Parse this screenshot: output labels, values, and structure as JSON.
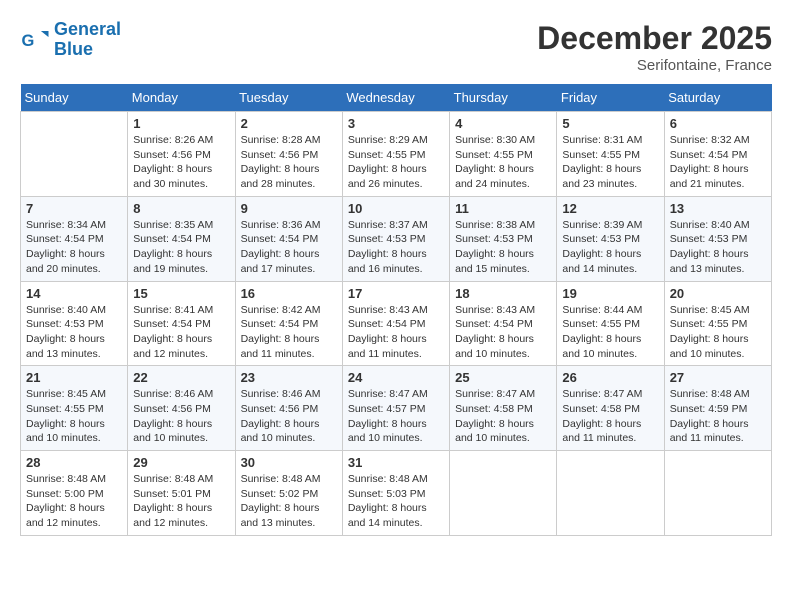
{
  "header": {
    "logo_line1": "General",
    "logo_line2": "Blue",
    "month_title": "December 2025",
    "location": "Serifontaine, France"
  },
  "days_of_week": [
    "Sunday",
    "Monday",
    "Tuesday",
    "Wednesday",
    "Thursday",
    "Friday",
    "Saturday"
  ],
  "weeks": [
    [
      {
        "day": "",
        "sunrise": "",
        "sunset": "",
        "daylight": ""
      },
      {
        "day": "1",
        "sunrise": "Sunrise: 8:26 AM",
        "sunset": "Sunset: 4:56 PM",
        "daylight": "Daylight: 8 hours and 30 minutes."
      },
      {
        "day": "2",
        "sunrise": "Sunrise: 8:28 AM",
        "sunset": "Sunset: 4:56 PM",
        "daylight": "Daylight: 8 hours and 28 minutes."
      },
      {
        "day": "3",
        "sunrise": "Sunrise: 8:29 AM",
        "sunset": "Sunset: 4:55 PM",
        "daylight": "Daylight: 8 hours and 26 minutes."
      },
      {
        "day": "4",
        "sunrise": "Sunrise: 8:30 AM",
        "sunset": "Sunset: 4:55 PM",
        "daylight": "Daylight: 8 hours and 24 minutes."
      },
      {
        "day": "5",
        "sunrise": "Sunrise: 8:31 AM",
        "sunset": "Sunset: 4:55 PM",
        "daylight": "Daylight: 8 hours and 23 minutes."
      },
      {
        "day": "6",
        "sunrise": "Sunrise: 8:32 AM",
        "sunset": "Sunset: 4:54 PM",
        "daylight": "Daylight: 8 hours and 21 minutes."
      }
    ],
    [
      {
        "day": "7",
        "sunrise": "Sunrise: 8:34 AM",
        "sunset": "Sunset: 4:54 PM",
        "daylight": "Daylight: 8 hours and 20 minutes."
      },
      {
        "day": "8",
        "sunrise": "Sunrise: 8:35 AM",
        "sunset": "Sunset: 4:54 PM",
        "daylight": "Daylight: 8 hours and 19 minutes."
      },
      {
        "day": "9",
        "sunrise": "Sunrise: 8:36 AM",
        "sunset": "Sunset: 4:54 PM",
        "daylight": "Daylight: 8 hours and 17 minutes."
      },
      {
        "day": "10",
        "sunrise": "Sunrise: 8:37 AM",
        "sunset": "Sunset: 4:53 PM",
        "daylight": "Daylight: 8 hours and 16 minutes."
      },
      {
        "day": "11",
        "sunrise": "Sunrise: 8:38 AM",
        "sunset": "Sunset: 4:53 PM",
        "daylight": "Daylight: 8 hours and 15 minutes."
      },
      {
        "day": "12",
        "sunrise": "Sunrise: 8:39 AM",
        "sunset": "Sunset: 4:53 PM",
        "daylight": "Daylight: 8 hours and 14 minutes."
      },
      {
        "day": "13",
        "sunrise": "Sunrise: 8:40 AM",
        "sunset": "Sunset: 4:53 PM",
        "daylight": "Daylight: 8 hours and 13 minutes."
      }
    ],
    [
      {
        "day": "14",
        "sunrise": "Sunrise: 8:40 AM",
        "sunset": "Sunset: 4:53 PM",
        "daylight": "Daylight: 8 hours and 13 minutes."
      },
      {
        "day": "15",
        "sunrise": "Sunrise: 8:41 AM",
        "sunset": "Sunset: 4:54 PM",
        "daylight": "Daylight: 8 hours and 12 minutes."
      },
      {
        "day": "16",
        "sunrise": "Sunrise: 8:42 AM",
        "sunset": "Sunset: 4:54 PM",
        "daylight": "Daylight: 8 hours and 11 minutes."
      },
      {
        "day": "17",
        "sunrise": "Sunrise: 8:43 AM",
        "sunset": "Sunset: 4:54 PM",
        "daylight": "Daylight: 8 hours and 11 minutes."
      },
      {
        "day": "18",
        "sunrise": "Sunrise: 8:43 AM",
        "sunset": "Sunset: 4:54 PM",
        "daylight": "Daylight: 8 hours and 10 minutes."
      },
      {
        "day": "19",
        "sunrise": "Sunrise: 8:44 AM",
        "sunset": "Sunset: 4:55 PM",
        "daylight": "Daylight: 8 hours and 10 minutes."
      },
      {
        "day": "20",
        "sunrise": "Sunrise: 8:45 AM",
        "sunset": "Sunset: 4:55 PM",
        "daylight": "Daylight: 8 hours and 10 minutes."
      }
    ],
    [
      {
        "day": "21",
        "sunrise": "Sunrise: 8:45 AM",
        "sunset": "Sunset: 4:55 PM",
        "daylight": "Daylight: 8 hours and 10 minutes."
      },
      {
        "day": "22",
        "sunrise": "Sunrise: 8:46 AM",
        "sunset": "Sunset: 4:56 PM",
        "daylight": "Daylight: 8 hours and 10 minutes."
      },
      {
        "day": "23",
        "sunrise": "Sunrise: 8:46 AM",
        "sunset": "Sunset: 4:56 PM",
        "daylight": "Daylight: 8 hours and 10 minutes."
      },
      {
        "day": "24",
        "sunrise": "Sunrise: 8:47 AM",
        "sunset": "Sunset: 4:57 PM",
        "daylight": "Daylight: 8 hours and 10 minutes."
      },
      {
        "day": "25",
        "sunrise": "Sunrise: 8:47 AM",
        "sunset": "Sunset: 4:58 PM",
        "daylight": "Daylight: 8 hours and 10 minutes."
      },
      {
        "day": "26",
        "sunrise": "Sunrise: 8:47 AM",
        "sunset": "Sunset: 4:58 PM",
        "daylight": "Daylight: 8 hours and 11 minutes."
      },
      {
        "day": "27",
        "sunrise": "Sunrise: 8:48 AM",
        "sunset": "Sunset: 4:59 PM",
        "daylight": "Daylight: 8 hours and 11 minutes."
      }
    ],
    [
      {
        "day": "28",
        "sunrise": "Sunrise: 8:48 AM",
        "sunset": "Sunset: 5:00 PM",
        "daylight": "Daylight: 8 hours and 12 minutes."
      },
      {
        "day": "29",
        "sunrise": "Sunrise: 8:48 AM",
        "sunset": "Sunset: 5:01 PM",
        "daylight": "Daylight: 8 hours and 12 minutes."
      },
      {
        "day": "30",
        "sunrise": "Sunrise: 8:48 AM",
        "sunset": "Sunset: 5:02 PM",
        "daylight": "Daylight: 8 hours and 13 minutes."
      },
      {
        "day": "31",
        "sunrise": "Sunrise: 8:48 AM",
        "sunset": "Sunset: 5:03 PM",
        "daylight": "Daylight: 8 hours and 14 minutes."
      },
      {
        "day": "",
        "sunrise": "",
        "sunset": "",
        "daylight": ""
      },
      {
        "day": "",
        "sunrise": "",
        "sunset": "",
        "daylight": ""
      },
      {
        "day": "",
        "sunrise": "",
        "sunset": "",
        "daylight": ""
      }
    ]
  ]
}
